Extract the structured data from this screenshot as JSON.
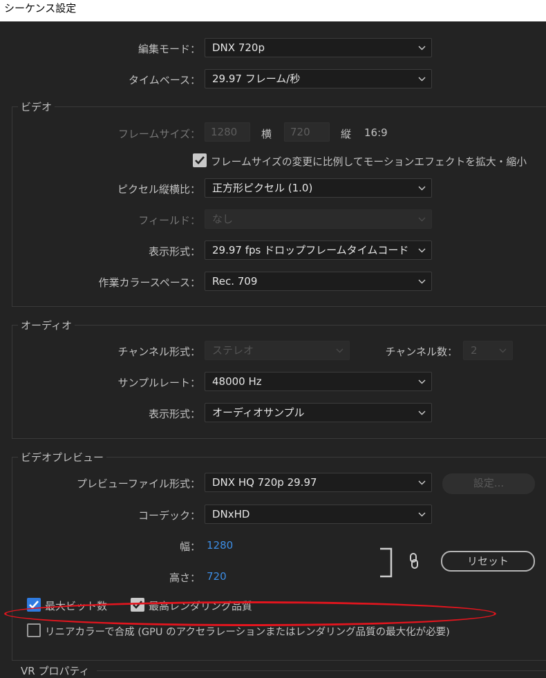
{
  "window": {
    "title": "シーケンス設定"
  },
  "top": {
    "edit_mode_label": "編集モード：",
    "edit_mode_value": "DNX 720p",
    "timebase_label": "タイムベース：",
    "timebase_value": "29.97  フレーム/秒"
  },
  "video": {
    "section_title": "ビデオ",
    "frame_size_label": "フレームサイズ：",
    "frame_width": "1280",
    "horizontal_label": "横",
    "frame_height": "720",
    "vertical_label": "縦",
    "aspect": "16:9",
    "scale_motion_label": "フレームサイズの変更に比例してモーションエフェクトを拡大・縮小",
    "scale_motion_checked": true,
    "pixel_aspect_label": "ピクセル縦横比：",
    "pixel_aspect_value": "正方形ピクセル (1.0)",
    "fields_label": "フィールド：",
    "fields_value": "なし",
    "display_format_label": "表示形式：",
    "display_format_value": "29.97  fps ドロップフレームタイムコード",
    "working_color_label": "作業カラースペース：",
    "working_color_value": "Rec. 709"
  },
  "audio": {
    "section_title": "オーディオ",
    "channel_format_label": "チャンネル形式：",
    "channel_format_value": "ステレオ",
    "channel_count_label": "チャンネル数：",
    "channel_count_value": "2",
    "sample_rate_label": "サンプルレート：",
    "sample_rate_value": "48000 Hz",
    "display_format_label": "表示形式：",
    "display_format_value": "オーディオサンプル"
  },
  "preview": {
    "section_title": "ビデオプレビュー",
    "file_format_label": "プレビューファイル形式：",
    "file_format_value": "DNX HQ 720p 29.97",
    "settings_button": "設定...",
    "codec_label": "コーデック：",
    "codec_value": "DNxHD",
    "width_label": "幅：",
    "width_value": "1280",
    "height_label": "高さ：",
    "height_value": "720",
    "reset_button": "リセット",
    "max_bit_depth_label": "最大ビット数",
    "max_bit_depth_checked": true,
    "max_render_label": "最高レンダリング品質",
    "max_render_checked": true,
    "linear_color_label": "リニアカラーで合成 (GPU のアクセラレーションまたはレンダリング品質の最大化が必要)",
    "linear_color_checked": false
  },
  "vr": {
    "section_title": "VR プロパティ"
  },
  "colors": {
    "accent": "#2f7be0",
    "value_blue": "#3d8ee5",
    "annotation_red": "#e3151e"
  }
}
